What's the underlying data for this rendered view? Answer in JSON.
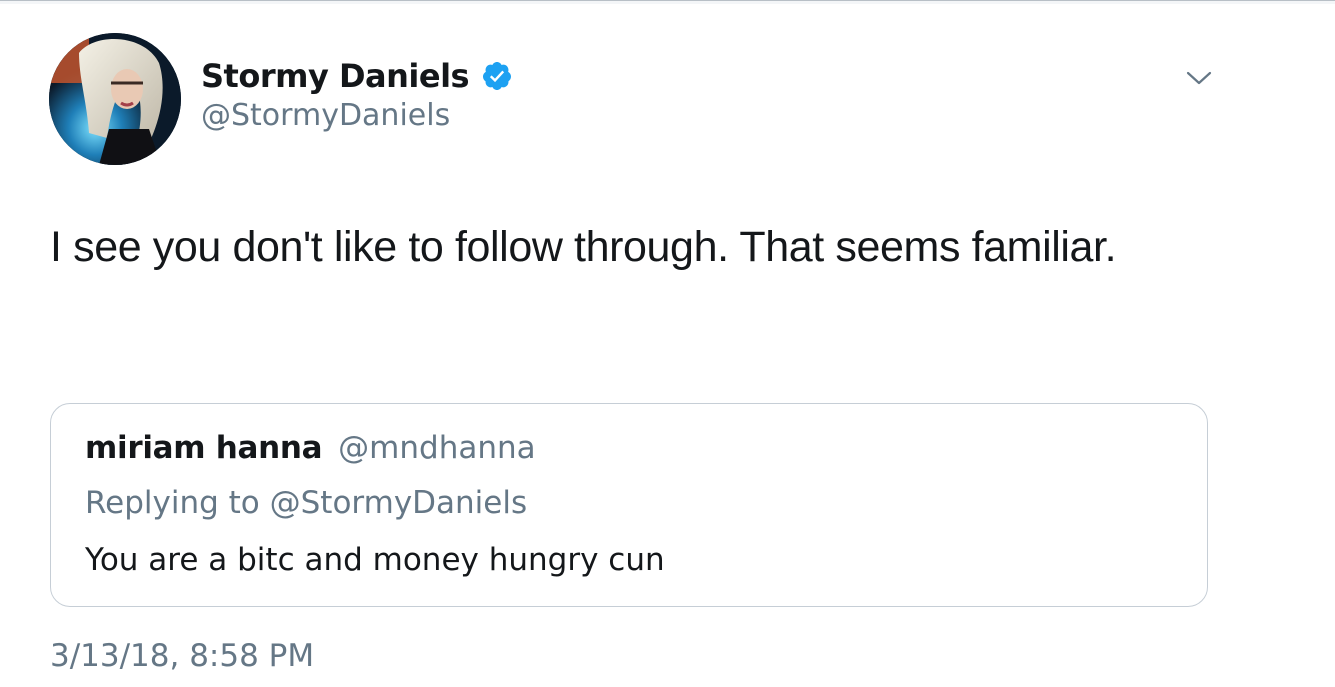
{
  "tweet": {
    "author": {
      "display_name": "Stormy Daniels",
      "handle": "@StormyDaniels",
      "verified": true,
      "avatar_icon": "profile-photo"
    },
    "text": "I see you don't like to follow through. That seems familiar.",
    "timestamp": "3/13/18, 8:58 PM",
    "more_icon": "chevron-down-icon"
  },
  "quoted_tweet": {
    "display_name": "miriam hanna",
    "handle": "@mndhanna",
    "replying_to": "Replying to @StormyDaniels",
    "text": "You are a bitc and money hungry cun"
  },
  "colors": {
    "verified_blue": "#1da1f2",
    "secondary_text": "#657786",
    "primary_text": "#14171a",
    "card_border": "#c6ced6"
  }
}
